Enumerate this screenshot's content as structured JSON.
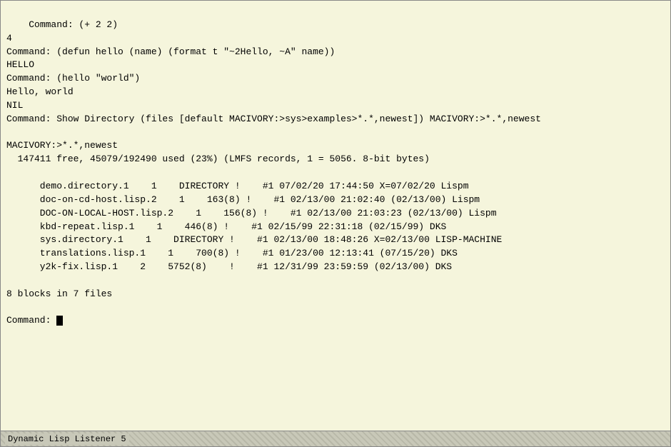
{
  "terminal": {
    "lines": [
      "Command: (+ 2 2)",
      "4",
      "Command: (defun hello (name) (format t \"~2Hello, ~A\" name))",
      "HELLO",
      "Command: (hello \"world\")",
      "Hello, world",
      "NIL",
      "Command: Show Directory (files [default MACIVORY:>sys>examples>*.*,newest]) MACIVORY:>*.*,newest",
      "",
      "MACIVORY:>*.*,newest",
      "  147411 free, 45079/192490 used (23%) (LMFS records, 1 = 5056. 8-bit bytes)",
      "",
      "      demo.directory.1    1    DIRECTORY !    #1 07/02/20 17:44:50 X=07/02/20 Lispm",
      "      doc-on-cd-host.lisp.2    1    163(8) !    #1 02/13/00 21:02:40 (02/13/00) Lispm",
      "      DOC-ON-LOCAL-HOST.lisp.2    1    156(8) !    #1 02/13/00 21:03:23 (02/13/00) Lispm",
      "      kbd-repeat.lisp.1    1    446(8) !    #1 02/15/99 22:31:18 (02/15/99) DKS",
      "      sys.directory.1    1    DIRECTORY !    #1 02/13/00 18:48:26 X=02/13/00 LISP-MACHINE",
      "      translations.lisp.1    1    700(8) !    #1 01/23/00 12:13:41 (07/15/20) DKS",
      "      y2k-fix.lisp.1    2    5752(8)    !    #1 12/31/99 23:59:59 (02/13/00) DKS",
      "",
      "8 blocks in 7 files",
      "",
      "Command: "
    ]
  },
  "statusBar": {
    "label": "Dynamic Lisp Listener 5"
  }
}
